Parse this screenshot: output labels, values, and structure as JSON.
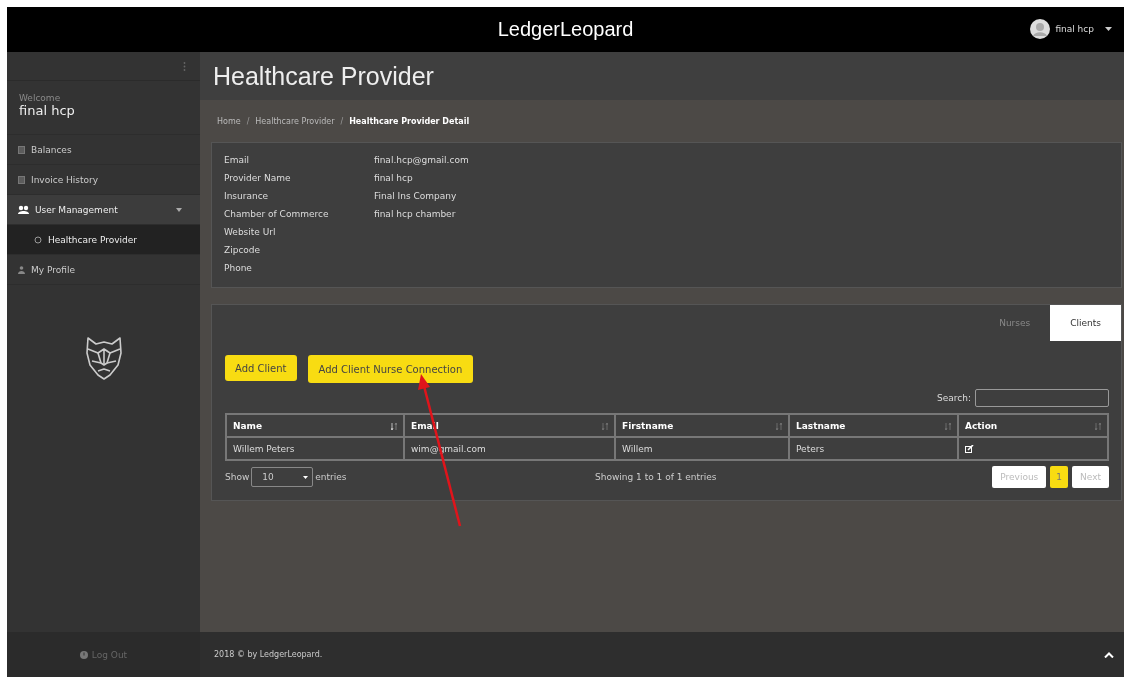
{
  "header": {
    "brand": "LedgerLeopard",
    "user": "final hcp"
  },
  "sidebar": {
    "welcome": "Welcome",
    "user_name": "final hcp",
    "items": [
      {
        "label": "Balances",
        "selected": false
      },
      {
        "label": "Invoice History",
        "selected": false
      },
      {
        "label": "User Management",
        "selected": false,
        "expanded": true,
        "children": [
          {
            "label": "Healthcare Provider",
            "selected": true
          }
        ]
      },
      {
        "label": "My Profile",
        "selected": false
      }
    ],
    "logout": "Log Out"
  },
  "page_title": "Healthcare Provider",
  "breadcrumb": [
    "Home",
    "/",
    "Healthcare Provider",
    "/",
    "Healthcare Provider Detail"
  ],
  "details": [
    {
      "label": "Email",
      "value": "final.hcp@gmail.com"
    },
    {
      "label": "Provider Name",
      "value": "final hcp"
    },
    {
      "label": "Insurance",
      "value": "Final Ins Company"
    },
    {
      "label": "Chamber of Commerce",
      "value": "final hcp chamber"
    },
    {
      "label": "Website Url"
    },
    {
      "label": "Zipcode"
    },
    {
      "label": "Phone"
    }
  ],
  "tabs": [
    {
      "label": "Nurses",
      "selected": false
    },
    {
      "label": "Clients",
      "selected": true
    }
  ],
  "buttons": [
    "Add Client",
    "Add Client Nurse Connection"
  ],
  "search": {
    "label": "Search:"
  },
  "table": {
    "columns": [
      "Name",
      "Email",
      "Firstname",
      "Lastname",
      "Action"
    ],
    "rows": [
      {
        "cells": [
          "Willem Peters",
          "wim@gmail.com",
          "Willem",
          "Peters"
        ]
      }
    ]
  },
  "length": {
    "show": "Show",
    "value": "10",
    "entries": "entries"
  },
  "info": "Showing 1 to 1 of 1 entries",
  "pagination": [
    {
      "label": "Previous",
      "selected": false,
      "disabled": true
    },
    {
      "label": "1",
      "selected": true,
      "disabled": false
    },
    {
      "label": "Next",
      "selected": false,
      "disabled": true
    }
  ],
  "footer": {
    "text": "2018 © by LedgerLeopard."
  }
}
